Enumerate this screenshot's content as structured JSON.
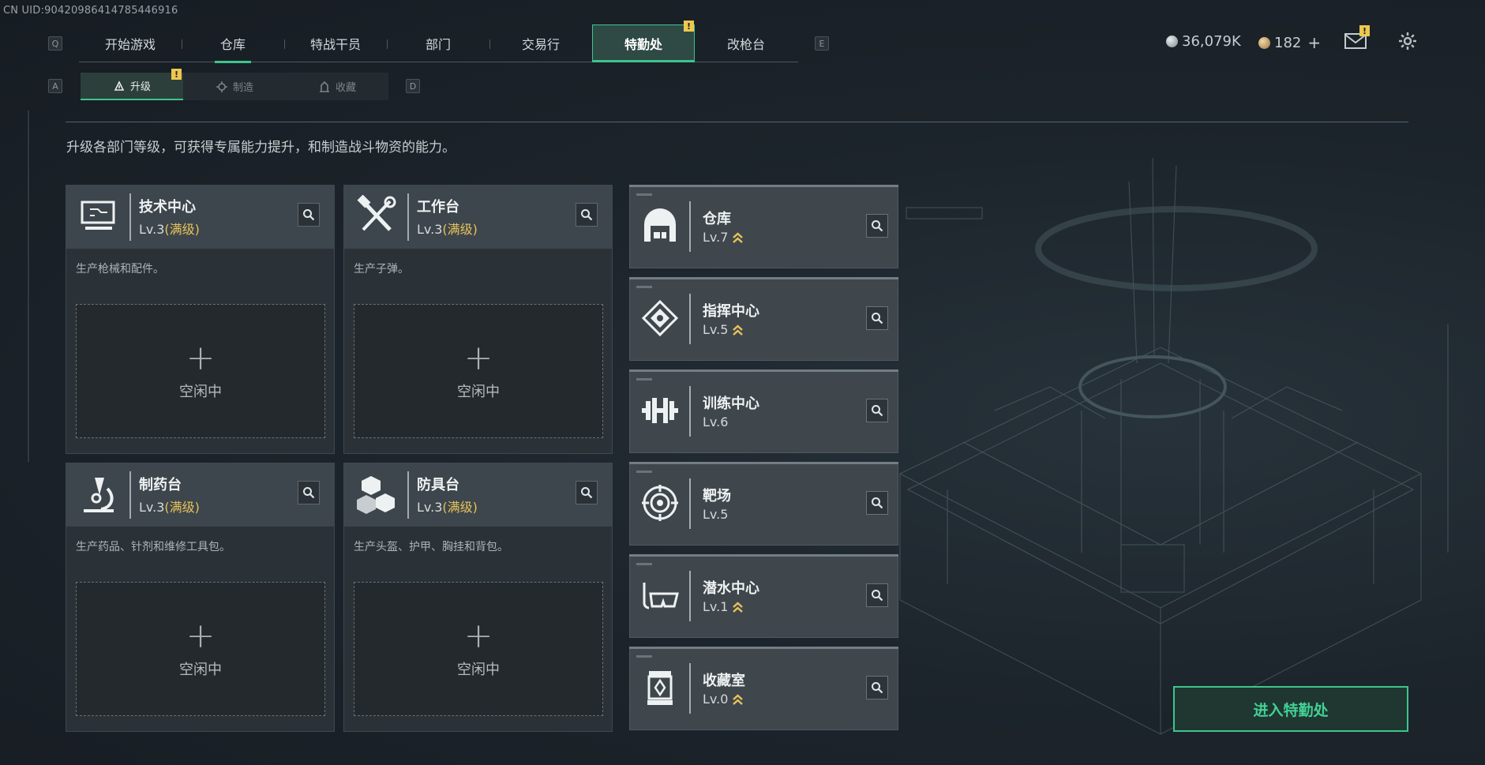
{
  "uid": "CN UID:9042098641478544691​6",
  "keys": {
    "q": "Q",
    "e": "E",
    "a": "A",
    "d": "D"
  },
  "topnav": {
    "tabs": [
      {
        "label": "开始游戏"
      },
      {
        "label": "仓库"
      },
      {
        "label": "特战干员"
      },
      {
        "label": "部门"
      },
      {
        "label": "交易行"
      },
      {
        "label": "特勤处"
      },
      {
        "label": "改枪台"
      }
    ],
    "active_index": 5,
    "warn": "!"
  },
  "resources": {
    "silver": "36,079K",
    "gold": "182",
    "gold_plus": "+"
  },
  "mail_warn": "!",
  "subnav": {
    "tabs": [
      {
        "label": "升级",
        "icon": "upgrade-icon"
      },
      {
        "label": "制造",
        "icon": "craft-icon"
      },
      {
        "label": "收藏",
        "icon": "collection-icon"
      }
    ],
    "warn": "!"
  },
  "description": "升级各部门等级，可获得专属能力提升，和制造战斗物资的能力。",
  "workbenches": [
    {
      "name": "技术中心",
      "level": "Lv.3",
      "max": "(满级)",
      "desc": "生产枪械和配件。",
      "plus": "+",
      "idle": "空闲中",
      "icon": "computer-icon"
    },
    {
      "name": "工作台",
      "level": "Lv.3",
      "max": "(满级)",
      "desc": "生产子弹。",
      "plus": "+",
      "idle": "空闲中",
      "icon": "tools-icon"
    },
    {
      "name": "制药台",
      "level": "Lv.3",
      "max": "(满级)",
      "desc": "生产药品、针剂和维修工具包。",
      "plus": "+",
      "idle": "空闲中",
      "icon": "microscope-icon"
    },
    {
      "name": "防具台",
      "level": "Lv.3",
      "max": "(满级)",
      "desc": "生产头盔、护甲、胸挂和背包。",
      "plus": "+",
      "idle": "空闲中",
      "icon": "cubes-icon"
    }
  ],
  "departments": [
    {
      "name": "仓库",
      "level": "Lv.7",
      "upgradable": true,
      "icon": "warehouse-icon"
    },
    {
      "name": "指挥中心",
      "level": "Lv.5",
      "upgradable": true,
      "icon": "chip-icon"
    },
    {
      "name": "训练中心",
      "level": "Lv.6",
      "upgradable": false,
      "icon": "dumbbell-icon"
    },
    {
      "name": "靶场",
      "level": "Lv.5",
      "upgradable": false,
      "icon": "target-icon"
    },
    {
      "name": "潜水中心",
      "level": "Lv.1",
      "upgradable": true,
      "icon": "diving-mask-icon"
    },
    {
      "name": "收藏室",
      "level": "Lv.0",
      "upgradable": true,
      "icon": "display-case-icon"
    }
  ],
  "enter_button": "进入特勤处",
  "colors": {
    "accent": "#3ec48c",
    "gold": "#e8c25b",
    "warn": "#ecc84f"
  }
}
